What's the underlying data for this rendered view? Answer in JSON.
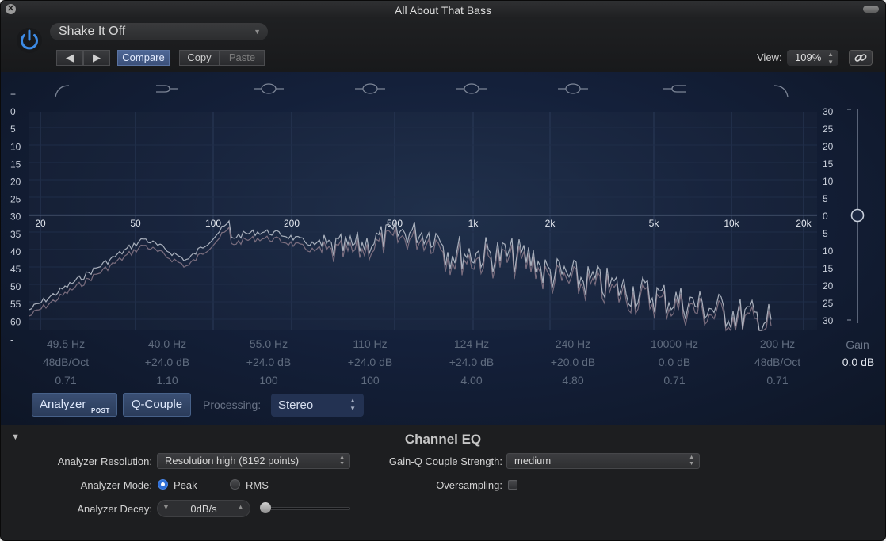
{
  "window": {
    "title": "All About That Bass"
  },
  "header": {
    "preset": "Shake It Off",
    "prev_label": "◀",
    "next_label": "▶",
    "compare_label": "Compare",
    "copy_label": "Copy",
    "paste_label": "Paste",
    "view_label": "View:",
    "zoom_value": "109%"
  },
  "eq": {
    "left_axis": [
      "+",
      "0",
      "5",
      "10",
      "15",
      "20",
      "25",
      "30",
      "35",
      "40",
      "45",
      "50",
      "55",
      "60",
      "-"
    ],
    "right_axis": [
      "30",
      "25",
      "20",
      "15",
      "10",
      "5",
      "0",
      "5",
      "10",
      "15",
      "20",
      "25",
      "30"
    ],
    "freq_labels": [
      "20",
      "50",
      "100",
      "200",
      "500",
      "1k",
      "2k",
      "5k",
      "10k",
      "20k"
    ],
    "bands": [
      {
        "icon": "low-cut-icon",
        "freq": "49.5 Hz",
        "gain": "48dB/Oct",
        "q": "0.71"
      },
      {
        "icon": "low-shelf-icon",
        "freq": "40.0 Hz",
        "gain": "+24.0 dB",
        "q": "1.10"
      },
      {
        "icon": "bell-icon",
        "freq": "55.0 Hz",
        "gain": "+24.0 dB",
        "q": "100"
      },
      {
        "icon": "bell-icon",
        "freq": "110 Hz",
        "gain": "+24.0 dB",
        "q": "100"
      },
      {
        "icon": "bell-icon",
        "freq": "124 Hz",
        "gain": "+24.0 dB",
        "q": "4.00"
      },
      {
        "icon": "bell-icon",
        "freq": "240 Hz",
        "gain": "+20.0 dB",
        "q": "4.80"
      },
      {
        "icon": "high-shelf-icon",
        "freq": "10000 Hz",
        "gain": "0.0 dB",
        "q": "0.71"
      },
      {
        "icon": "high-cut-icon",
        "freq": "200 Hz",
        "gain": "48dB/Oct",
        "q": "0.71"
      }
    ],
    "gain_label": "Gain",
    "gain_value": "0.0 dB",
    "analyzer_label": "Analyzer",
    "analyzer_badge": "POST",
    "qcouple_label": "Q-Couple",
    "processing_label": "Processing:",
    "processing_value": "Stereo",
    "colors": {
      "background": "#14203a",
      "analyzer_trace": "#b8bfca",
      "analyzer_trace_2": "#8c7a8a",
      "button_active": "#3a4f73"
    }
  },
  "footer": {
    "title": "Channel EQ",
    "analyzer_resolution_label": "Analyzer Resolution:",
    "analyzer_resolution_value": "Resolution high (8192 points)",
    "gainq_label": "Gain-Q Couple Strength:",
    "gainq_value": "medium",
    "analyzer_mode_label": "Analyzer Mode:",
    "mode_peak": "Peak",
    "mode_rms": "RMS",
    "mode_selected": "Peak",
    "oversampling_label": "Oversampling:",
    "oversampling_checked": false,
    "analyzer_decay_label": "Analyzer Decay:",
    "analyzer_decay_value": "0dB/s"
  }
}
